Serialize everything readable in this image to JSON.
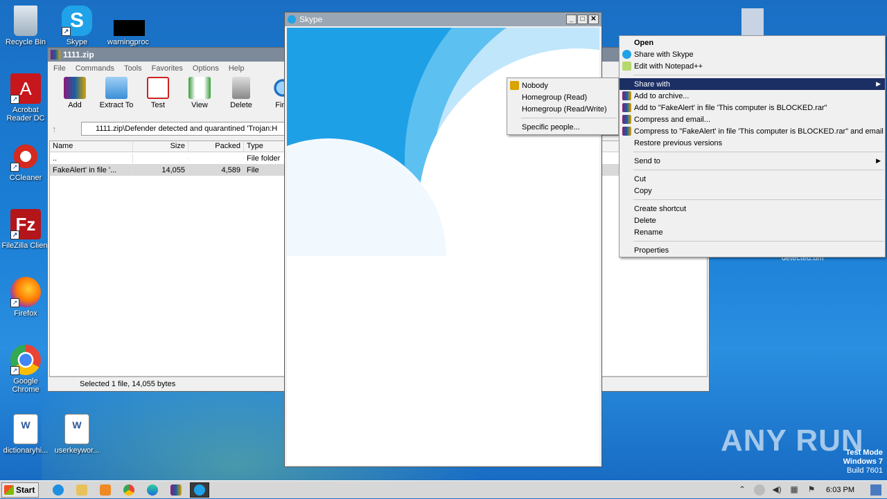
{
  "desktop": {
    "icons": [
      {
        "label": "Recycle Bin"
      },
      {
        "label": "Skype"
      },
      {
        "label": "warningproc"
      },
      {
        "label": "Acrobat Reader DC"
      },
      {
        "label": "CCleaner"
      },
      {
        "label": "FileZilla Client"
      },
      {
        "label": "Firefox"
      },
      {
        "label": "Google Chrome"
      },
      {
        "label": "dictionaryhi..."
      },
      {
        "label": "userkeywor..."
      }
    ],
    "partial_label": "detected.um"
  },
  "rar_window": {
    "title": "1111.zip",
    "menu": [
      "File",
      "Commands",
      "Tools",
      "Favorites",
      "Options",
      "Help"
    ],
    "toolbar": [
      "Add",
      "Extract To",
      "Test",
      "View",
      "Delete",
      "Find"
    ],
    "path": "1111.zip\\Defender detected and quarantined 'Trojan:H",
    "columns": {
      "name": "Name",
      "size": "Size",
      "packed": "Packed",
      "type": "Type"
    },
    "rows": [
      {
        "name": "..",
        "size": "",
        "packed": "",
        "type": "File folder"
      },
      {
        "name": "FakeAlert' in file '...",
        "size": "14,055",
        "packed": "4,589",
        "type": "File"
      }
    ],
    "status": "Selected 1 file, 14,055 bytes"
  },
  "skype_window": {
    "title": "Skype",
    "min": "_",
    "max": "□",
    "close": "✕"
  },
  "context_menu": {
    "items": [
      {
        "label": "Open"
      },
      {
        "label": "Share with Skype"
      },
      {
        "label": "Edit with Notepad++"
      },
      {
        "label": "Share with"
      },
      {
        "label": "Add to archive..."
      },
      {
        "label": "Add to \"FakeAlert' in file 'This computer is BLOCKED.rar\""
      },
      {
        "label": "Compress and email..."
      },
      {
        "label": "Compress to \"FakeAlert' in file 'This computer is BLOCKED.rar\" and email"
      },
      {
        "label": "Restore previous versions"
      },
      {
        "label": "Send to"
      },
      {
        "label": "Cut"
      },
      {
        "label": "Copy"
      },
      {
        "label": "Create shortcut"
      },
      {
        "label": "Delete"
      },
      {
        "label": "Rename"
      },
      {
        "label": "Properties"
      }
    ]
  },
  "share_submenu": {
    "items": [
      {
        "label": "Nobody"
      },
      {
        "label": "Homegroup (Read)"
      },
      {
        "label": "Homegroup (Read/Write)"
      },
      {
        "label": "Specific people..."
      }
    ]
  },
  "taskbar": {
    "start": "Start",
    "clock": "6:03 PM"
  },
  "watermark": "ANY RUN",
  "test_mode": {
    "line1": "Test Mode",
    "line2": "Windows 7",
    "line3": "Build 7601"
  },
  "colors": {
    "menu_highlight": "#1b2f64",
    "desktop": "#1b7fd6"
  }
}
